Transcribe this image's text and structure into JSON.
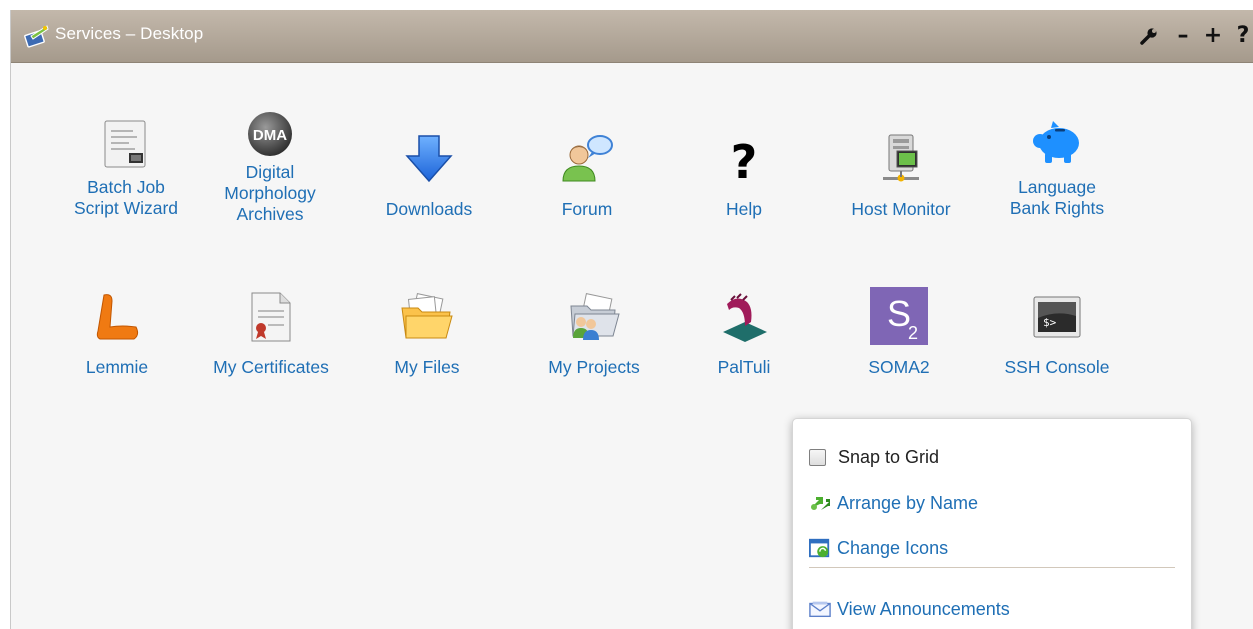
{
  "window": {
    "title": "Services – Desktop",
    "controls": {
      "settings": "settings-wrench",
      "minimize": "–",
      "maximize": "+",
      "help": "?"
    }
  },
  "desktop_icons": [
    {
      "label_lines": [
        "Batch Job",
        "Script Wizard"
      ],
      "icon": "script-document-icon"
    },
    {
      "label_lines": [
        "Digital",
        "Morphology",
        "Archives"
      ],
      "icon": "dma-badge-icon",
      "badge_text": "DMA"
    },
    {
      "label_lines": [
        "Downloads"
      ],
      "icon": "download-arrow-icon"
    },
    {
      "label_lines": [
        "Forum"
      ],
      "icon": "forum-user-icon"
    },
    {
      "label_lines": [
        "Help"
      ],
      "icon": "question-mark-icon"
    },
    {
      "label_lines": [
        "Host Monitor"
      ],
      "icon": "host-monitor-icon"
    },
    {
      "label_lines": [
        "Language",
        "Bank Rights"
      ],
      "icon": "piggy-bank-icon"
    },
    {
      "label_lines": [
        "Lemmie"
      ],
      "icon": "lemmie-l-icon"
    },
    {
      "label_lines": [
        "My Certificates"
      ],
      "icon": "certificate-icon"
    },
    {
      "label_lines": [
        "My Files"
      ],
      "icon": "folder-files-icon"
    },
    {
      "label_lines": [
        "My Projects"
      ],
      "icon": "projects-folder-icon"
    },
    {
      "label_lines": [
        "PalTuli"
      ],
      "icon": "paltuli-icon"
    },
    {
      "label_lines": [
        "SOMA2"
      ],
      "icon": "soma2-icon",
      "badge_text": "S2"
    },
    {
      "label_lines": [
        "SSH Console"
      ],
      "icon": "ssh-console-icon",
      "badge_text": "$>"
    }
  ],
  "context_menu": {
    "snap_to_grid": {
      "label": "Snap to Grid",
      "checked": false
    },
    "arrange_by_name": {
      "label": "Arrange by Name",
      "icon": "arrange-arrows-icon"
    },
    "change_icons": {
      "label": "Change Icons",
      "icon": "change-icons-icon"
    },
    "view_announcements": {
      "label": "View Announcements",
      "icon": "announcements-icon"
    }
  },
  "colors": {
    "link": "#1f6fb5",
    "titlebar": "#b0a597",
    "desktop_background": "#f6f6f6"
  }
}
